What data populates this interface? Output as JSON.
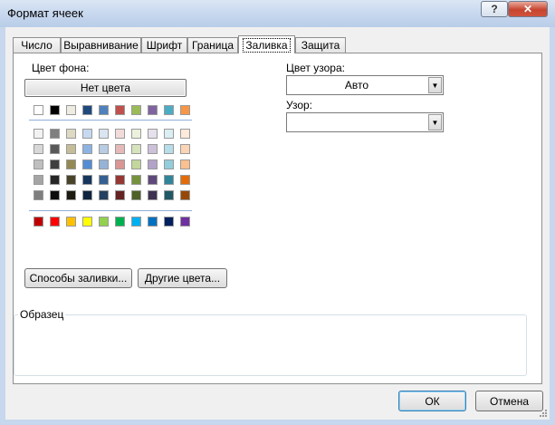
{
  "window": {
    "title": "Формат ячеек",
    "help_label": "?",
    "close_label": "✕"
  },
  "tabs": [
    {
      "label": "Число"
    },
    {
      "label": "Выравнивание"
    },
    {
      "label": "Шрифт"
    },
    {
      "label": "Граница"
    },
    {
      "label": "Заливка",
      "active": true
    },
    {
      "label": "Защита"
    }
  ],
  "fill": {
    "bg_color_label": "Цвет фона:",
    "no_color_button": "Нет цвета",
    "theme_top": [
      "#ffffff",
      "#000000",
      "#eeece1",
      "#1f497d",
      "#4f81bd",
      "#c0504d",
      "#9bbb59",
      "#8064a2",
      "#4bacc6",
      "#f79646"
    ],
    "theme_shades": [
      [
        "#f2f2f2",
        "#7f7f7f",
        "#ddd9c3",
        "#c6d9f0",
        "#dbe5f1",
        "#f2dcdb",
        "#ebf1dd",
        "#e5e0ec",
        "#dbeef3",
        "#fdeada"
      ],
      [
        "#d8d8d8",
        "#595959",
        "#c4bd97",
        "#8db3e2",
        "#b8cce4",
        "#e5b9b7",
        "#d7e3bc",
        "#ccc1d9",
        "#b7dde8",
        "#fbd5b5"
      ],
      [
        "#bfbfbf",
        "#3f3f3f",
        "#938953",
        "#548dd4",
        "#95b3d7",
        "#d99694",
        "#c3d69b",
        "#b2a2c7",
        "#92cddc",
        "#fac08f"
      ],
      [
        "#a5a5a5",
        "#262626",
        "#494429",
        "#17365d",
        "#366092",
        "#953734",
        "#76923c",
        "#5f497a",
        "#31859b",
        "#e36c09"
      ],
      [
        "#7f7f7f",
        "#0c0c0c",
        "#1d1b10",
        "#0f243e",
        "#244061",
        "#632423",
        "#4f6128",
        "#3f3151",
        "#205867",
        "#974806"
      ]
    ],
    "standard": [
      "#c00000",
      "#ff0000",
      "#ffc000",
      "#ffff00",
      "#92d050",
      "#00b050",
      "#00b0f0",
      "#0070c0",
      "#002060",
      "#7030a0"
    ],
    "fill_effects_button": "Способы заливки...",
    "more_colors_button": "Другие цвета...",
    "pattern_color_label": "Цвет узора:",
    "pattern_color_value": "Авто",
    "pattern_style_label": "Узор:",
    "pattern_style_value": "",
    "sample_label": "Образец"
  },
  "footer": {
    "ok": "ОК",
    "cancel": "Отмена"
  }
}
